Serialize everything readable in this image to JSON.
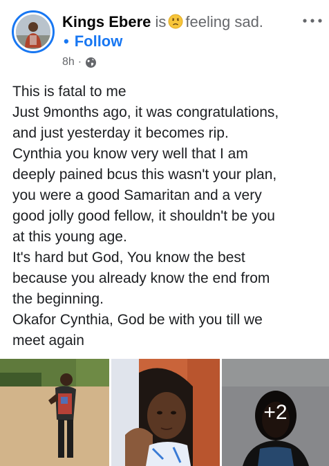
{
  "post": {
    "author_name": "Kings Ebere",
    "activity_prefix": "is",
    "activity_text": "feeling sad.",
    "activity_emoji": "sad-face-emoji",
    "follow_dot": "•",
    "follow_label": "Follow",
    "timestamp": "8h",
    "meta_separator": "·",
    "privacy_icon": "globe-icon",
    "more_icon": "more-options-icon",
    "body_lines": [
      "This is fatal to me",
      "Just 9months ago, it was congratulations,",
      "and just yesterday it becomes rip.",
      "Cynthia you know very well that I am",
      "deeply pained bcus this wasn't your plan,",
      "you were a good Samaritan and a very",
      "good jolly good fellow, it shouldn't be you",
      "at this young age.",
      "It's hard but God, You know the best",
      "because you already know the end from",
      "the beginning.",
      "Okafor Cynthia, God be with you till we",
      "meet again"
    ],
    "photos": {
      "more_count": "+2"
    }
  },
  "colors": {
    "accent": "#1877f2",
    "text_primary": "#1c1e21",
    "text_secondary": "#65676b"
  }
}
